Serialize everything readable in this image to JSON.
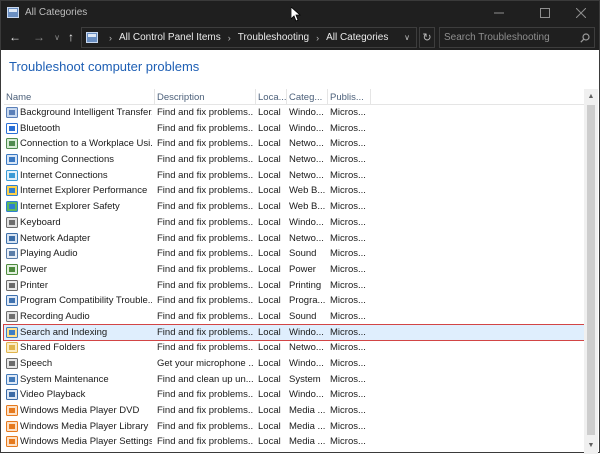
{
  "window": {
    "title": "All Categories",
    "app_icon": "control-panel-icon"
  },
  "titlebar_controls": {
    "minimize": "—",
    "maximize": "☐",
    "close": "✕"
  },
  "nav": {
    "back": "←",
    "forward": "→",
    "dropdown": "∨",
    "up": "↑"
  },
  "breadcrumb": {
    "items": [
      "All Control Panel Items",
      "Troubleshooting",
      "All Categories"
    ],
    "separator": "›",
    "dropdown": "∨"
  },
  "refresh": "↻",
  "search": {
    "placeholder": "Search Troubleshooting",
    "value": ""
  },
  "page_title": "Troubleshoot computer problems",
  "columns": [
    "Name",
    "Description",
    "Loca...",
    "Categ...",
    "Publis..."
  ],
  "rows": [
    {
      "name": "Background Intelligent Transfer...",
      "desc": "Find and fix problems...",
      "loc": "Local",
      "cat": "Windo...",
      "pub": "Micros...",
      "icon": "bits-icon"
    },
    {
      "name": "Bluetooth",
      "desc": "Find and fix problems...",
      "loc": "Local",
      "cat": "Windo...",
      "pub": "Micros...",
      "icon": "bluetooth-icon"
    },
    {
      "name": "Connection to a Workplace Usi...",
      "desc": "Find and fix problems...",
      "loc": "Local",
      "cat": "Netwo...",
      "pub": "Micros...",
      "icon": "workplace-icon"
    },
    {
      "name": "Incoming Connections",
      "desc": "Find and fix problems...",
      "loc": "Local",
      "cat": "Netwo...",
      "pub": "Micros...",
      "icon": "incoming-icon"
    },
    {
      "name": "Internet Connections",
      "desc": "Find and fix problems...",
      "loc": "Local",
      "cat": "Netwo...",
      "pub": "Micros...",
      "icon": "internet-icon"
    },
    {
      "name": "Internet Explorer Performance",
      "desc": "Find and fix problems...",
      "loc": "Local",
      "cat": "Web B...",
      "pub": "Micros...",
      "icon": "ie-performance-icon"
    },
    {
      "name": "Internet Explorer Safety",
      "desc": "Find and fix problems...",
      "loc": "Local",
      "cat": "Web B...",
      "pub": "Micros...",
      "icon": "ie-safety-icon"
    },
    {
      "name": "Keyboard",
      "desc": "Find and fix problems...",
      "loc": "Local",
      "cat": "Windo...",
      "pub": "Micros...",
      "icon": "keyboard-icon"
    },
    {
      "name": "Network Adapter",
      "desc": "Find and fix problems...",
      "loc": "Local",
      "cat": "Netwo...",
      "pub": "Micros...",
      "icon": "network-adapter-icon"
    },
    {
      "name": "Playing Audio",
      "desc": "Find and fix problems...",
      "loc": "Local",
      "cat": "Sound",
      "pub": "Micros...",
      "icon": "audio-icon"
    },
    {
      "name": "Power",
      "desc": "Find and fix problems...",
      "loc": "Local",
      "cat": "Power",
      "pub": "Micros...",
      "icon": "power-icon"
    },
    {
      "name": "Printer",
      "desc": "Find and fix problems...",
      "loc": "Local",
      "cat": "Printing",
      "pub": "Micros...",
      "icon": "printer-icon"
    },
    {
      "name": "Program Compatibility Trouble...",
      "desc": "Find and fix problems...",
      "loc": "Local",
      "cat": "Progra...",
      "pub": "Micros...",
      "icon": "compat-icon"
    },
    {
      "name": "Recording Audio",
      "desc": "Find and fix problems...",
      "loc": "Local",
      "cat": "Sound",
      "pub": "Micros...",
      "icon": "microphone-icon"
    },
    {
      "name": "Search and Indexing",
      "desc": "Find and fix problems...",
      "loc": "Local",
      "cat": "Windo...",
      "pub": "Micros...",
      "icon": "search-indexing-icon",
      "selected": true
    },
    {
      "name": "Shared Folders",
      "desc": "Find and fix problems...",
      "loc": "Local",
      "cat": "Netwo...",
      "pub": "Micros...",
      "icon": "shared-folder-icon"
    },
    {
      "name": "Speech",
      "desc": "Get your microphone ...",
      "loc": "Local",
      "cat": "Windo...",
      "pub": "Micros...",
      "icon": "speech-icon"
    },
    {
      "name": "System Maintenance",
      "desc": "Find and clean up un...",
      "loc": "Local",
      "cat": "System",
      "pub": "Micros...",
      "icon": "maintenance-icon"
    },
    {
      "name": "Video Playback",
      "desc": "Find and fix problems...",
      "loc": "Local",
      "cat": "Windo...",
      "pub": "Micros...",
      "icon": "video-icon"
    },
    {
      "name": "Windows Media Player DVD",
      "desc": "Find and fix problems...",
      "loc": "Local",
      "cat": "Media ...",
      "pub": "Micros...",
      "icon": "wmp-dvd-icon"
    },
    {
      "name": "Windows Media Player Library",
      "desc": "Find and fix problems...",
      "loc": "Local",
      "cat": "Media ...",
      "pub": "Micros...",
      "icon": "wmp-library-icon"
    },
    {
      "name": "Windows Media Player Settings",
      "desc": "Find and fix problems...",
      "loc": "Local",
      "cat": "Media ...",
      "pub": "Micros...",
      "icon": "wmp-settings-icon"
    }
  ],
  "colors": {
    "titlebar_bg": "#1f1f1f",
    "page_title": "#1e5fb4",
    "selection_outline": "#d24545",
    "selection_fill": "#dfeefd"
  },
  "scrollbar": {
    "up": "▲",
    "down": "▼"
  }
}
